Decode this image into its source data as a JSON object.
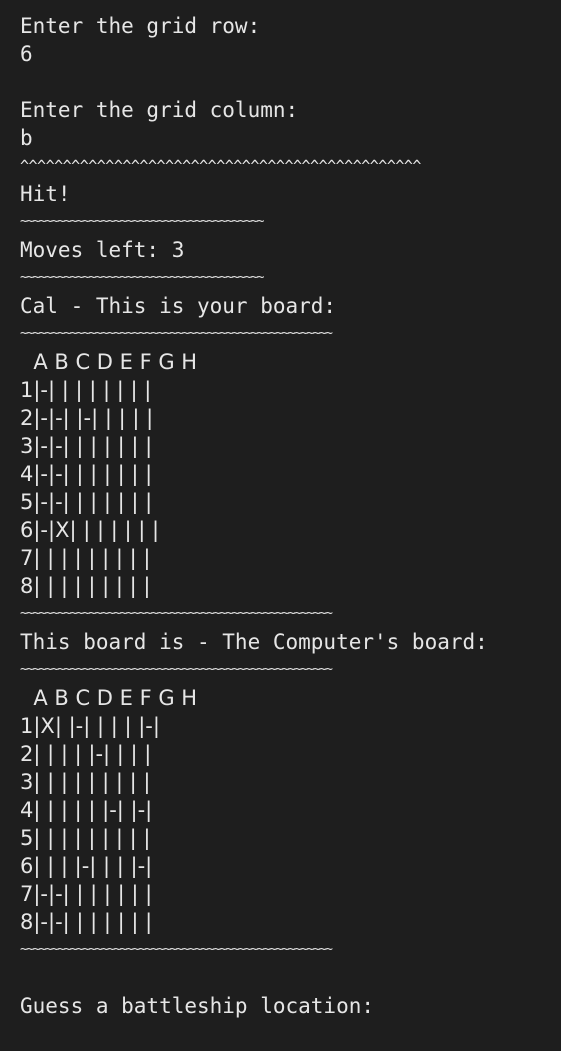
{
  "lines": {
    "row_prompt": "Enter the grid row:",
    "row_value": "6",
    "blank1": "",
    "col_prompt": "Enter the grid column:",
    "col_value": "b",
    "caret_rule": "^^^^^^^^^^^^^^^^^^^^^^^^^^^^^^^^^^^^^^^^^^^^^^^",
    "result": "Hit!",
    "wave_short": "~~~~~~~~~~~~~~~~~~~~~~~~~~~~~~~~~~~~~~~",
    "moves": "Moves left: 3",
    "player_board_title": "Cal - This is your board:",
    "wave_long": "~~~~~~~~~~~~~~~~~~~~~~~~~~~~~~~~~~~~~~~~~~~~~~~~~~",
    "computer_board_title": "This board is - The Computer's board:",
    "guess_prompt": "Guess a battleship location:"
  },
  "player_board": {
    "header": "  A B C D E F G H",
    "rows": [
      "1|-| | | | | | | |",
      "2|-|-| |-| | | | |",
      "3|-|-| | | | | | |",
      "4|-|-| | | | | | |",
      "5|-|-| | | | | | |",
      "6|-|X| | | | | | |",
      "7| | | | | | | | |",
      "8| | | | | | | | |"
    ]
  },
  "computer_board": {
    "header": "  A B C D E F G H",
    "rows": [
      "1|X| |-| | | | |-|",
      "2| | | | |-| | | |",
      "3| | | | | | | | |",
      "4| | | | | |-| |-|",
      "5| | | | | | | | |",
      "6| | | |-| | | |-|",
      "7|-|-| | | | | | |",
      "8|-|-| | | | | | |"
    ]
  }
}
